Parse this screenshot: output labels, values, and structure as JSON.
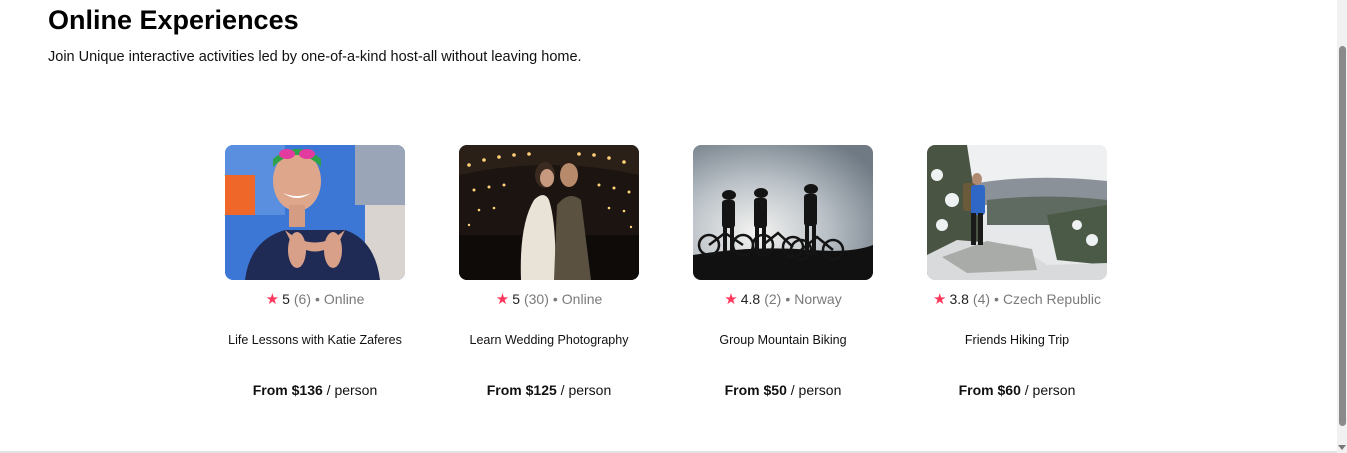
{
  "header": {
    "title": "Online Experiences",
    "subtitle": "Join Unique interactive activities led by one-of-a-kind host-all without leaving home."
  },
  "colors": {
    "star": "#fe385c",
    "muted": "#7a7a7a"
  },
  "experiences": [
    {
      "rating": "5",
      "review_count": "(6)",
      "location": "Online",
      "title": "Life Lessons with Katie Zaferes",
      "price": "From $136",
      "price_unit": "/ person",
      "image": "swimmer-photo"
    },
    {
      "rating": "5",
      "review_count": "(30)",
      "location": "Online",
      "title": "Learn Wedding Photography",
      "price": "From $125",
      "price_unit": "/ person",
      "image": "wedding-couple-photo"
    },
    {
      "rating": "4.8",
      "review_count": "(2)",
      "location": "Norway",
      "title": "Group Mountain Biking",
      "price": "From $50",
      "price_unit": "/ person",
      "image": "mountain-bikers-photo"
    },
    {
      "rating": "3.8",
      "review_count": "(4)",
      "location": "Czech Republic",
      "title": "Friends Hiking Trip",
      "price": "From $60",
      "price_unit": "/ person",
      "image": "hiker-photo"
    }
  ]
}
